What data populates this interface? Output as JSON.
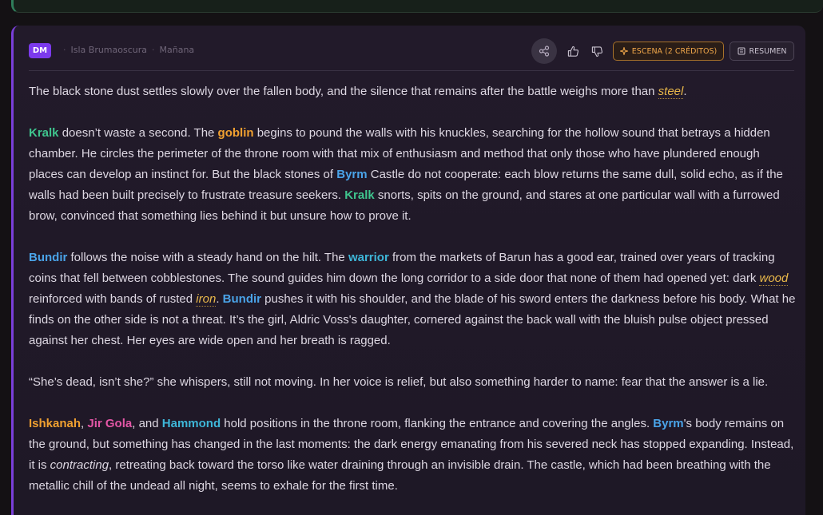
{
  "header": {
    "badge": "DM",
    "location": "Isla Brumaoscura",
    "time": "Mañana",
    "share_icon": "share-icon",
    "thumbs_up_icon": "thumbs-up-icon",
    "thumbs_down_icon": "thumbs-down-icon",
    "escena_label": "ESCENA (2 CRÉDITOS)",
    "resumen_label": "RESUMEN"
  },
  "colors": {
    "accent": "#7c3aed",
    "escena": "#f0a74a",
    "character_green": "#3fc58e",
    "character_orange": "#f0a030",
    "character_blue": "#4aa3e8",
    "character_pink": "#e356a6",
    "item": "#e9b84a"
  },
  "story": {
    "p1": {
      "t1": "The black stone dust settles slowly over the fallen body, and the silence that remains after the battle weighs more than ",
      "item1": "steel",
      "t2": "."
    },
    "p2": {
      "name1": "Kralk",
      "t1": " doesn’t waste a second. The ",
      "class1": "goblin",
      "t2": " begins to pound the walls with his knuckles, searching for the hollow sound that betrays a hidden chamber. He circles the perimeter of the throne room with that mix of enthusiasm and method that only those who have plundered enough places can develop an instinct for. But the black stones of ",
      "place1": "Byrm",
      "t3": " Castle do not cooperate: each blow returns the same dull, solid echo, as if the walls had been built precisely to frustrate treasure seekers. ",
      "name2": "Kralk",
      "t4": " snorts, spits on the ground, and stares at one particular wall with a furrowed brow, convinced that something lies behind it but unsure how to prove it."
    },
    "p3": {
      "name1": "Bundir",
      "t1": " follows the noise with a steady hand on the hilt. The ",
      "class1": "warrior",
      "t2": " from the markets of Barun has a good ear, trained over years of tracking coins that fell between cobblestones. The sound guides him down the long corridor to a side door that none of them had opened yet: dark ",
      "item1": "wood",
      "t3": " reinforced with bands of rusted ",
      "item2": "iron",
      "t4": ". ",
      "name2": "Bundir",
      "t5": " pushes it with his shoulder, and the blade of his sword enters the darkness before his body. What he finds on the other side is not a threat. It’s the girl, Aldric Voss's daughter, cornered against the back wall with the bluish pulse object pressed against her chest. Her eyes are wide open and her breath is ragged."
    },
    "p4": {
      "t1": "“She’s dead, isn’t she?” she whispers, still not moving. In her voice is relief, but also something harder to name: fear that the answer is a lie."
    },
    "p5": {
      "name1": "Ishkanah",
      "t1": ", ",
      "name2": "Jir Gola",
      "t2": ", and ",
      "name3": "Hammond",
      "t3": " hold positions in the throne room, flanking the entrance and covering the angles. ",
      "name4": "Byrm",
      "t4": "'s body remains on the ground, but something has changed in the last moments: the dark energy emanating from his severed neck has stopped expanding. Instead, it is ",
      "em1": "contracting",
      "t5": ", retreating back toward the torso like water draining through an invisible drain. The castle, which had been breathing with the metallic chill of the undead all night, seems to exhale for the first time."
    }
  }
}
